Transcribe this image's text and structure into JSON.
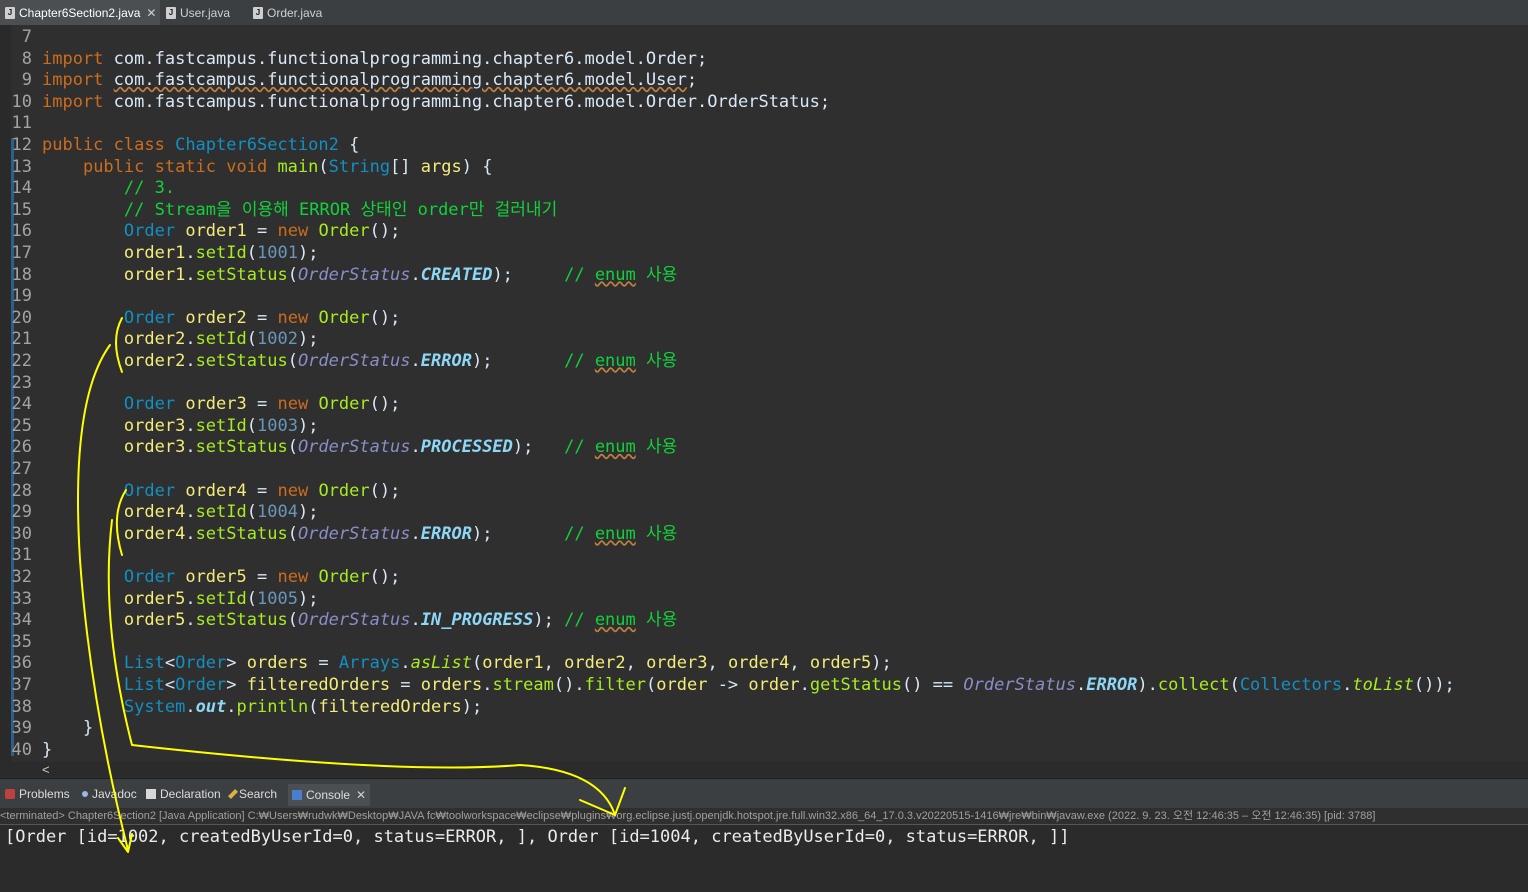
{
  "tabs": [
    {
      "label": "Chapter6Section2.java",
      "active": true
    },
    {
      "label": "User.java",
      "active": false
    },
    {
      "label": "Order.java",
      "active": false
    }
  ],
  "editor": {
    "lines": [
      {
        "n": "7",
        "html": ""
      },
      {
        "n": "8",
        "html": "<span class='kw'>import</span> com.fastcampus.functionalprogramming.chapter6.model.Order;"
      },
      {
        "n": "9",
        "html": "<span class='kw'>import</span> <span class='und'>com.fastcampus.functionalprogramming.chapter6.model.User</span>;"
      },
      {
        "n": "10",
        "html": "<span class='kw'>import</span> com.fastcampus.functionalprogramming.chapter6.model.Order.OrderStatus;"
      },
      {
        "n": "11",
        "html": ""
      },
      {
        "n": "12",
        "html": "<span class='kw'>public class</span> <span class='cls'>Chapter6Section2</span> {"
      },
      {
        "n": "13",
        "html": "    <span class='kw'>public static void</span> <span class='fn'>main</span>(<span class='typ'>String</span>[] <span class='var'>args</span>) {"
      },
      {
        "n": "14",
        "html": "        <span class='cmtg'>// 3.</span>"
      },
      {
        "n": "15",
        "html": "        <span class='cmtg'>// Stream을 이용해 ERROR 상태인 order만 걸러내기</span>"
      },
      {
        "n": "16",
        "html": "        <span class='typ'>Order</span> <span class='var'>order1</span> = <span class='kw'>new</span> <span class='fn'>Order</span>();"
      },
      {
        "n": "17",
        "html": "        <span class='var'>order1</span>.<span class='fn'>setId</span>(<span class='num'>1001</span>);"
      },
      {
        "n": "18",
        "html": "        <span class='var'>order1</span>.<span class='fn'>setStatus</span>(<span class='enumc'>OrderStatus</span>.<span class='statf'>CREATED</span>);     <span class='cmtg'>// <span class='und'>enum</span> 사용</span>"
      },
      {
        "n": "19",
        "html": ""
      },
      {
        "n": "20",
        "html": "        <span class='typ'>Order</span> <span class='var'>order2</span> = <span class='kw'>new</span> <span class='fn'>Order</span>();"
      },
      {
        "n": "21",
        "html": "        <span class='var'>order2</span>.<span class='fn'>setId</span>(<span class='num'>1002</span>);"
      },
      {
        "n": "22",
        "html": "        <span class='var'>order2</span>.<span class='fn'>setStatus</span>(<span class='enumc'>OrderStatus</span>.<span class='statf'>ERROR</span>);       <span class='cmtg'>// <span class='und'>enum</span> 사용</span>"
      },
      {
        "n": "23",
        "html": ""
      },
      {
        "n": "24",
        "html": "        <span class='typ'>Order</span> <span class='var'>order3</span> = <span class='kw'>new</span> <span class='fn'>Order</span>();"
      },
      {
        "n": "25",
        "html": "        <span class='var'>order3</span>.<span class='fn'>setId</span>(<span class='num'>1003</span>);"
      },
      {
        "n": "26",
        "html": "        <span class='var'>order3</span>.<span class='fn'>setStatus</span>(<span class='enumc'>OrderStatus</span>.<span class='statf'>PROCESSED</span>);   <span class='cmtg'>// <span class='und'>enum</span> 사용</span>"
      },
      {
        "n": "27",
        "html": ""
      },
      {
        "n": "28",
        "html": "        <span class='typ'>Order</span> <span class='var'>order4</span> = <span class='kw'>new</span> <span class='fn'>Order</span>();"
      },
      {
        "n": "29",
        "html": "        <span class='var'>order4</span>.<span class='fn'>setId</span>(<span class='num'>1004</span>);"
      },
      {
        "n": "30",
        "html": "        <span class='var'>order4</span>.<span class='fn'>setStatus</span>(<span class='enumc'>OrderStatus</span>.<span class='statf'>ERROR</span>);       <span class='cmtg'>// <span class='und'>enum</span> 사용</span>"
      },
      {
        "n": "31",
        "html": ""
      },
      {
        "n": "32",
        "html": "        <span class='typ'>Order</span> <span class='var'>order5</span> = <span class='kw'>new</span> <span class='fn'>Order</span>();"
      },
      {
        "n": "33",
        "html": "        <span class='var'>order5</span>.<span class='fn'>setId</span>(<span class='num'>1005</span>);"
      },
      {
        "n": "34",
        "html": "        <span class='var'>order5</span>.<span class='fn'>setStatus</span>(<span class='enumc'>OrderStatus</span>.<span class='statf'>IN_PROGRESS</span>); <span class='cmtg'>// <span class='und'>enum</span> 사용</span>"
      },
      {
        "n": "35",
        "html": ""
      },
      {
        "n": "36",
        "html": "        <span class='typ'>List</span>&lt;<span class='typ'>Order</span>&gt; <span class='var'>orders</span> = <span class='typ'>Arrays</span>.<span class='fn'><i>asList</i></span>(<span class='var'>order1</span>, <span class='var'>order2</span>, <span class='var'>order3</span>, <span class='var'>order4</span>, <span class='var'>order5</span>);"
      },
      {
        "n": "37",
        "html": "        <span class='typ'>List</span>&lt;<span class='typ'>Order</span>&gt; <span class='var'>filteredOrders</span> = <span class='var'>orders</span>.<span class='fn'>stream</span>().<span class='fn'>filter</span>(<span class='var'>order</span> -&gt; <span class='var'>order</span>.<span class='fn'>getStatus</span>() == <span class='enumc'>OrderStatus</span>.<span class='statf'>ERROR</span>).<span class='fn'>collect</span>(<span class='typ'>Collectors</span>.<span class='fn'><i>toList</i></span>());"
      },
      {
        "n": "38",
        "html": "        <span class='typ'>System</span>.<span class='statf'>out</span>.<span class='fn'>println</span>(<span class='var'>filteredOrders</span>);"
      },
      {
        "n": "39",
        "html": "    }"
      },
      {
        "n": "40",
        "html": "}"
      }
    ]
  },
  "views": [
    {
      "label": "Problems",
      "active": false
    },
    {
      "label": "Javadoc",
      "active": false
    },
    {
      "label": "Declaration",
      "active": false
    },
    {
      "label": "Search",
      "active": false
    },
    {
      "label": "Console",
      "active": true
    }
  ],
  "console": {
    "status": "<terminated> Chapter6Section2 [Java Application] C:₩Users₩rudwk₩Desktop₩JAVA fc₩toolworkspace₩eclipse₩plugins₩org.eclipse.justj.openjdk.hotspot.jre.full.win32.x86_64_17.0.3.v20220515-1416₩jre₩bin₩javaw.exe  (2022. 9. 23. 오전 12:46:35 – 오전 12:46:35) [pid: 3788]",
    "output": "[Order [id=1002, createdByUserId=0, status=ERROR, ], Order [id=1004, createdByUserId=0, status=ERROR, ]]"
  },
  "colors": {
    "background": "#2f2f2f",
    "keyword": "#cc6c1d",
    "type": "#1290c3",
    "method": "#a7ec21",
    "variable": "#f3ec79",
    "comment": "#12d13b",
    "annotation": "#ffff00"
  }
}
